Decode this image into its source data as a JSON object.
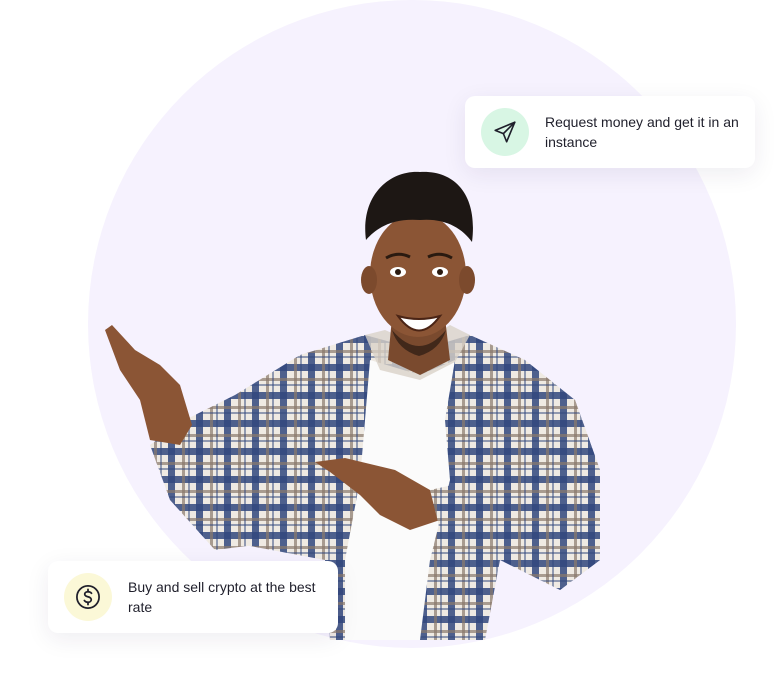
{
  "cards": {
    "request": {
      "text": "Request money and get it in an instance",
      "icon": "send-icon",
      "icon_bg": "#d8f6e4"
    },
    "crypto": {
      "text": "Buy and sell crypto at the best rate",
      "icon": "dollar-coin-icon",
      "icon_bg": "#fbf8d7"
    }
  },
  "colors": {
    "background": "#ffffff",
    "circle": "#f6f2fe",
    "text": "#1f1f2b",
    "icon_stroke": "#1f1f2b"
  }
}
